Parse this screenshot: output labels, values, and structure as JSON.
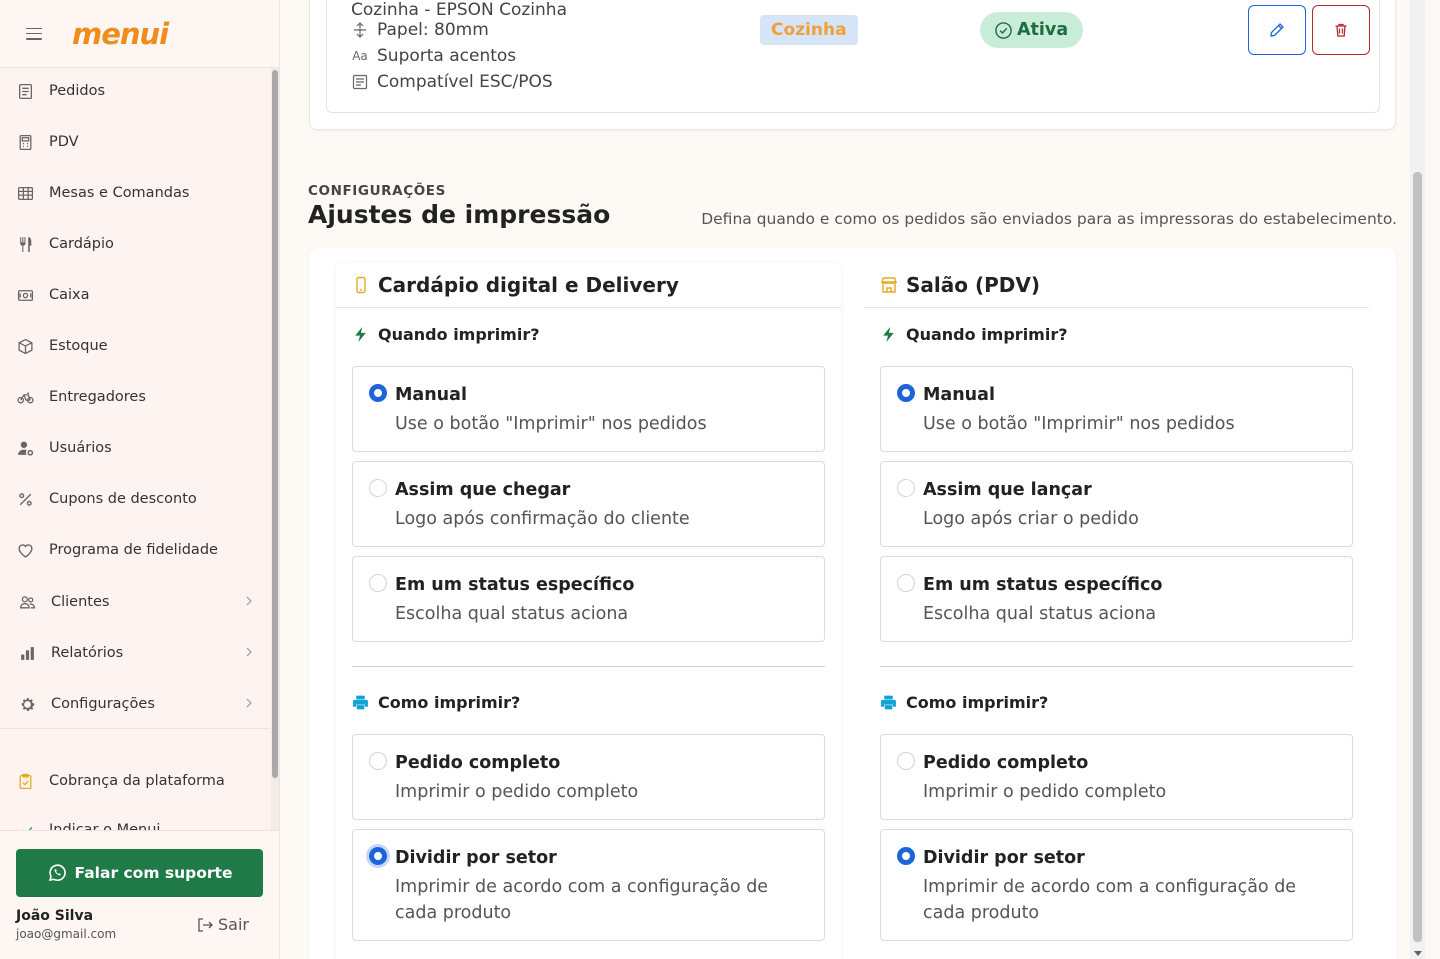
{
  "app": {
    "logo": "menui"
  },
  "sidebar": {
    "items": [
      {
        "label": "Pedidos",
        "icon": "receipt-icon"
      },
      {
        "label": "PDV",
        "icon": "calculator-icon"
      },
      {
        "label": "Mesas e Comandas",
        "icon": "table-icon"
      },
      {
        "label": "Cardápio",
        "icon": "cutlery-icon"
      },
      {
        "label": "Caixa",
        "icon": "cash-icon"
      },
      {
        "label": "Estoque",
        "icon": "box-icon"
      },
      {
        "label": "Entregadores",
        "icon": "bicycle-icon"
      },
      {
        "label": "Usuários",
        "icon": "user-gear-icon"
      },
      {
        "label": "Cupons de desconto",
        "icon": "percent-icon"
      },
      {
        "label": "Programa de fidelidade",
        "icon": "heart-icon"
      },
      {
        "label": "Clientes",
        "icon": "people-icon",
        "expandable": true
      },
      {
        "label": "Relatórios",
        "icon": "bar-chart-icon",
        "expandable": true
      },
      {
        "label": "Configurações",
        "icon": "gear-icon",
        "expandable": true
      },
      {
        "label": "Cobrança da plataforma",
        "icon": "clipboard-icon"
      },
      {
        "label": "Indicar o Menui",
        "icon": "share-icon"
      }
    ],
    "support_button": "Falar com suporte",
    "user": {
      "name": "João Silva",
      "email": "joao@gmail.com"
    },
    "logout_label": "Sair"
  },
  "printer": {
    "name": "Cozinha - EPSON Cozinha",
    "paper": "Papel: 80mm",
    "accents": "Suporta acentos",
    "escpos": "Compatível ESC/POS",
    "sector_badge": "Cozinha",
    "status_badge": "Ativa"
  },
  "print_settings": {
    "kicker": "CONFIGURAÇÕES",
    "title": "Ajustes de impressão",
    "description": "Defina quando e como os pedidos são enviados para as impressoras do estabelecimento.",
    "columns": [
      {
        "title": "Cardápio digital e Delivery",
        "icon": "phone-icon",
        "when_label": "Quando imprimir?",
        "when_options": [
          {
            "title": "Manual",
            "desc": "Use o botão \"Imprimir\" nos pedidos",
            "selected": true
          },
          {
            "title": "Assim que chegar",
            "desc": "Logo após confirmação do cliente",
            "selected": false
          },
          {
            "title": "Em um status específico",
            "desc": "Escolha qual status aciona",
            "selected": false
          }
        ],
        "how_label": "Como imprimir?",
        "how_options": [
          {
            "title": "Pedido completo",
            "desc": "Imprimir o pedido completo",
            "selected": false
          },
          {
            "title": "Dividir por setor",
            "desc": "Imprimir de acordo com a configuração de cada produto",
            "selected": true
          }
        ]
      },
      {
        "title": "Salão (PDV)",
        "icon": "shop-icon",
        "when_label": "Quando imprimir?",
        "when_options": [
          {
            "title": "Manual",
            "desc": "Use o botão \"Imprimir\" nos pedidos",
            "selected": true
          },
          {
            "title": "Assim que lançar",
            "desc": "Logo após criar o pedido",
            "selected": false
          },
          {
            "title": "Em um status específico",
            "desc": "Escolha qual status aciona",
            "selected": false
          }
        ],
        "how_label": "Como imprimir?",
        "how_options": [
          {
            "title": "Pedido completo",
            "desc": "Imprimir o pedido completo",
            "selected": false
          },
          {
            "title": "Dividir por setor",
            "desc": "Imprimir de acordo com a configuração de cada produto",
            "selected": true
          }
        ]
      }
    ]
  },
  "colors": {
    "brand": "#f08c1a",
    "primary": "#1c64d8",
    "success": "#1f7a47",
    "danger": "#b52a2a",
    "accent_icon": "#e8a921"
  }
}
